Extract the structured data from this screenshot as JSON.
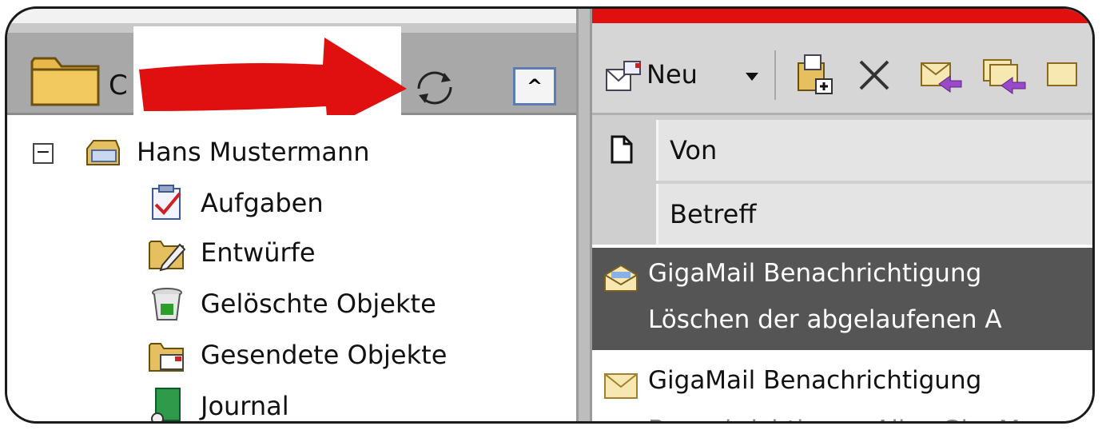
{
  "left_pane": {
    "header_text": "C",
    "collapse_symbol": "^",
    "tree": {
      "root": "Hans Mustermann",
      "expander": "−",
      "items": [
        {
          "label": "Aufgaben",
          "icon": "tasks-icon"
        },
        {
          "label": "Entwürfe",
          "icon": "drafts-icon"
        },
        {
          "label": "Gelöschte Objekte",
          "icon": "trash-icon"
        },
        {
          "label": "Gesendete Objekte",
          "icon": "sent-icon"
        },
        {
          "label": "Journal",
          "icon": "journal-icon"
        }
      ]
    }
  },
  "toolbar": {
    "new_label": "Neu",
    "icons": [
      "new-mail-icon",
      "dropdown-arrow-icon",
      "move-to-folder-icon",
      "delete-icon",
      "reply-icon",
      "reply-all-icon"
    ]
  },
  "columns": {
    "from": "Von",
    "subject": "Betreff"
  },
  "messages": [
    {
      "sender": "GigaMail Benachrichtigung",
      "subject": "Löschen der abgelaufenen A",
      "selected": true
    },
    {
      "sender": "GigaMail Benachrichtigung",
      "subject": "Benachrichtigung Alice GigaM",
      "selected": false
    }
  ],
  "colors": {
    "annotation_arrow": "#e01010",
    "selected_row": "#555555",
    "collapse_border": "#5b7bb5"
  }
}
